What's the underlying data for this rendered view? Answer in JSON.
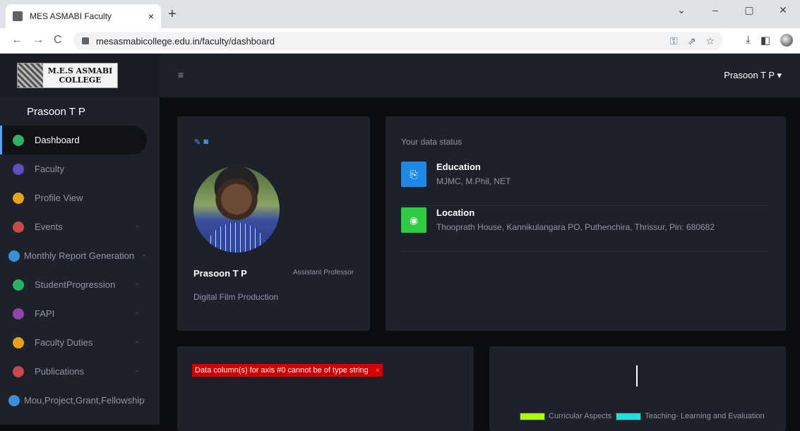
{
  "browser": {
    "tab_title": "MES ASMABI Faculty",
    "tab_close": "×",
    "new_tab": "+",
    "url": "mesasmabicollege.edu.in/faculty/dashboard",
    "nav_back": "←",
    "nav_forward": "→",
    "nav_reload": "C"
  },
  "app": {
    "logo_line1": "M.E.S ASMABI",
    "logo_line2": "COLLEGE",
    "sidebar_user": "Prasoon T P",
    "top_user": "Prasoon T P ▾",
    "menu": [
      {
        "label": "Dashboard",
        "color": "#28b463",
        "active": true
      },
      {
        "label": "Faculty",
        "color": "#5b4fc2"
      },
      {
        "label": "Profile View",
        "color": "#e8a21a"
      },
      {
        "label": "Events",
        "color": "#c94848",
        "chevron": true
      },
      {
        "label": "Monthly Report Generation",
        "color": "#3a8fd9",
        "chevron": true
      },
      {
        "label": "StudentProgression",
        "color": "#28b463",
        "chevron": true
      },
      {
        "label": "FAPI",
        "color": "#8e44ad",
        "chevron": true
      },
      {
        "label": "Faculty Duties",
        "color": "#e8a21a",
        "chevron": true
      },
      {
        "label": "Publications",
        "color": "#c94848",
        "chevron": true
      },
      {
        "label": "Mou,Project,Grant,Fellowship",
        "color": "#3a8fd9",
        "chevron": true
      }
    ]
  },
  "profile": {
    "name": "Prasoon T P",
    "role": "Assistant Professor",
    "department": "Digital Film Production"
  },
  "status": {
    "title": "Your data status",
    "rows": [
      {
        "label": "Education",
        "value": "MJMC, M.Phil, NET",
        "color": "#1e88e5"
      },
      {
        "label": "Location",
        "value": "Thooprath House, Kannikulangara PO, Puthenchira, Thrissur, Pin: 680682",
        "color": "#2ecc40"
      }
    ]
  },
  "charts": {
    "error_text": "Data column(s) for axis #0 cannot be of type string",
    "error_close": "×",
    "legend": [
      {
        "label": "Curricular Aspects",
        "color": "#aaff00"
      },
      {
        "label": "Teaching- Learning and Evaluation",
        "color": "#1ee0e0"
      }
    ]
  }
}
